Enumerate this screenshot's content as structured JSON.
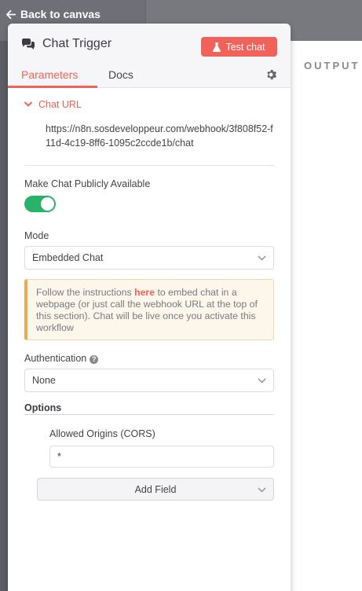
{
  "nav": {
    "back_label": "Back to canvas"
  },
  "output": {
    "label": "OUTPUT"
  },
  "panel": {
    "title": "Chat Trigger",
    "test_button": "Test chat",
    "tabs": [
      {
        "label": "Parameters"
      },
      {
        "label": "Docs"
      }
    ]
  },
  "chat_url": {
    "section_label": "Chat URL",
    "url": "https://n8n.sosdeveloppeur.com/webhook/3f808f52-f11d-4c19-8ff6-1095c2ccde1b/chat"
  },
  "public": {
    "label": "Make Chat Publicly Available",
    "enabled": true
  },
  "mode": {
    "label": "Mode",
    "value": "Embedded Chat"
  },
  "notice": {
    "before": "Follow the instructions ",
    "link": "here",
    "after": " to embed chat in a webpage (or just call the webhook URL at the top of this section). Chat will be live once you activate this workflow"
  },
  "authentication": {
    "label": "Authentication",
    "help_icon": "?",
    "value": "None"
  },
  "options": {
    "label": "Options",
    "allowed_origins_label": "Allowed Origins (CORS)",
    "allowed_origins_value": "*",
    "add_field_label": "Add Field"
  },
  "colors": {
    "accent": "#f0625a",
    "toggle_on": "#29b36a",
    "notice_border": "#f0a84f"
  },
  "icons": {
    "back": "arrow-left-icon",
    "title": "chat-bubbles-icon",
    "test": "flask-icon",
    "settings": "gear-icon",
    "section": "chevron-down-icon",
    "select": "chevron-down-icon"
  }
}
